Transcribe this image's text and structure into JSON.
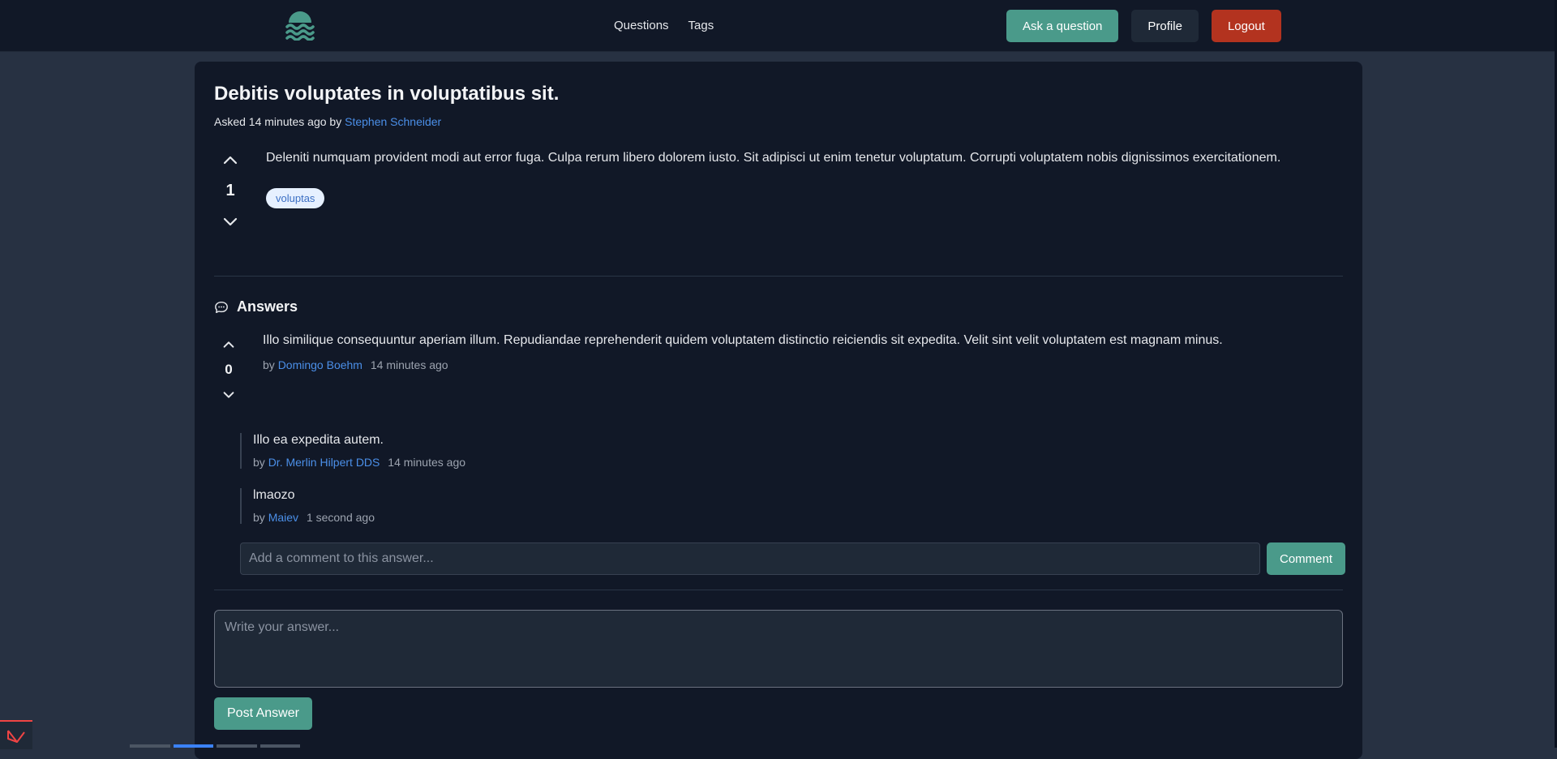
{
  "nav": {
    "links": [
      "Questions",
      "Tags"
    ],
    "ask_label": "Ask a question",
    "profile_label": "Profile",
    "logout_label": "Logout"
  },
  "question": {
    "title": "Debitis voluptates in voluptatibus sit.",
    "asked_prefix": "Asked 14 minutes ago by",
    "author": "Stephen Schneider",
    "votes": "1",
    "body": "Deleniti numquam provident modi aut error fuga. Culpa rerum libero dolorem iusto. Sit adipisci ut enim tenetur voluptatum. Corrupti voluptatem nobis dignissimos exercitationem.",
    "tags": [
      "voluptas"
    ]
  },
  "answers_heading": "Answers",
  "answer": {
    "votes": "0",
    "body": "Illo similique consequuntur aperiam illum. Repudiandae reprehenderit quidem voluptatem distinctio reiciendis sit expedita. Velit sint velit voluptatem est magnam minus.",
    "by_label": "by",
    "author": "Domingo Boehm",
    "time": "14 minutes ago",
    "comments": [
      {
        "text": "Illo ea expedita autem.",
        "by_label": "by",
        "author": "Dr. Merlin Hilpert DDS",
        "time": "14 minutes ago"
      },
      {
        "text": "lmaozo",
        "by_label": "by",
        "author": "Maiev",
        "time": "1 second ago"
      }
    ],
    "comment_placeholder": "Add a comment to this answer...",
    "comment_button": "Comment"
  },
  "answer_form": {
    "placeholder": "Write your answer...",
    "post_label": "Post Answer"
  },
  "colors": {
    "accent": "#4a9a8a",
    "danger": "#b3331f",
    "link": "#4b8fe8"
  }
}
